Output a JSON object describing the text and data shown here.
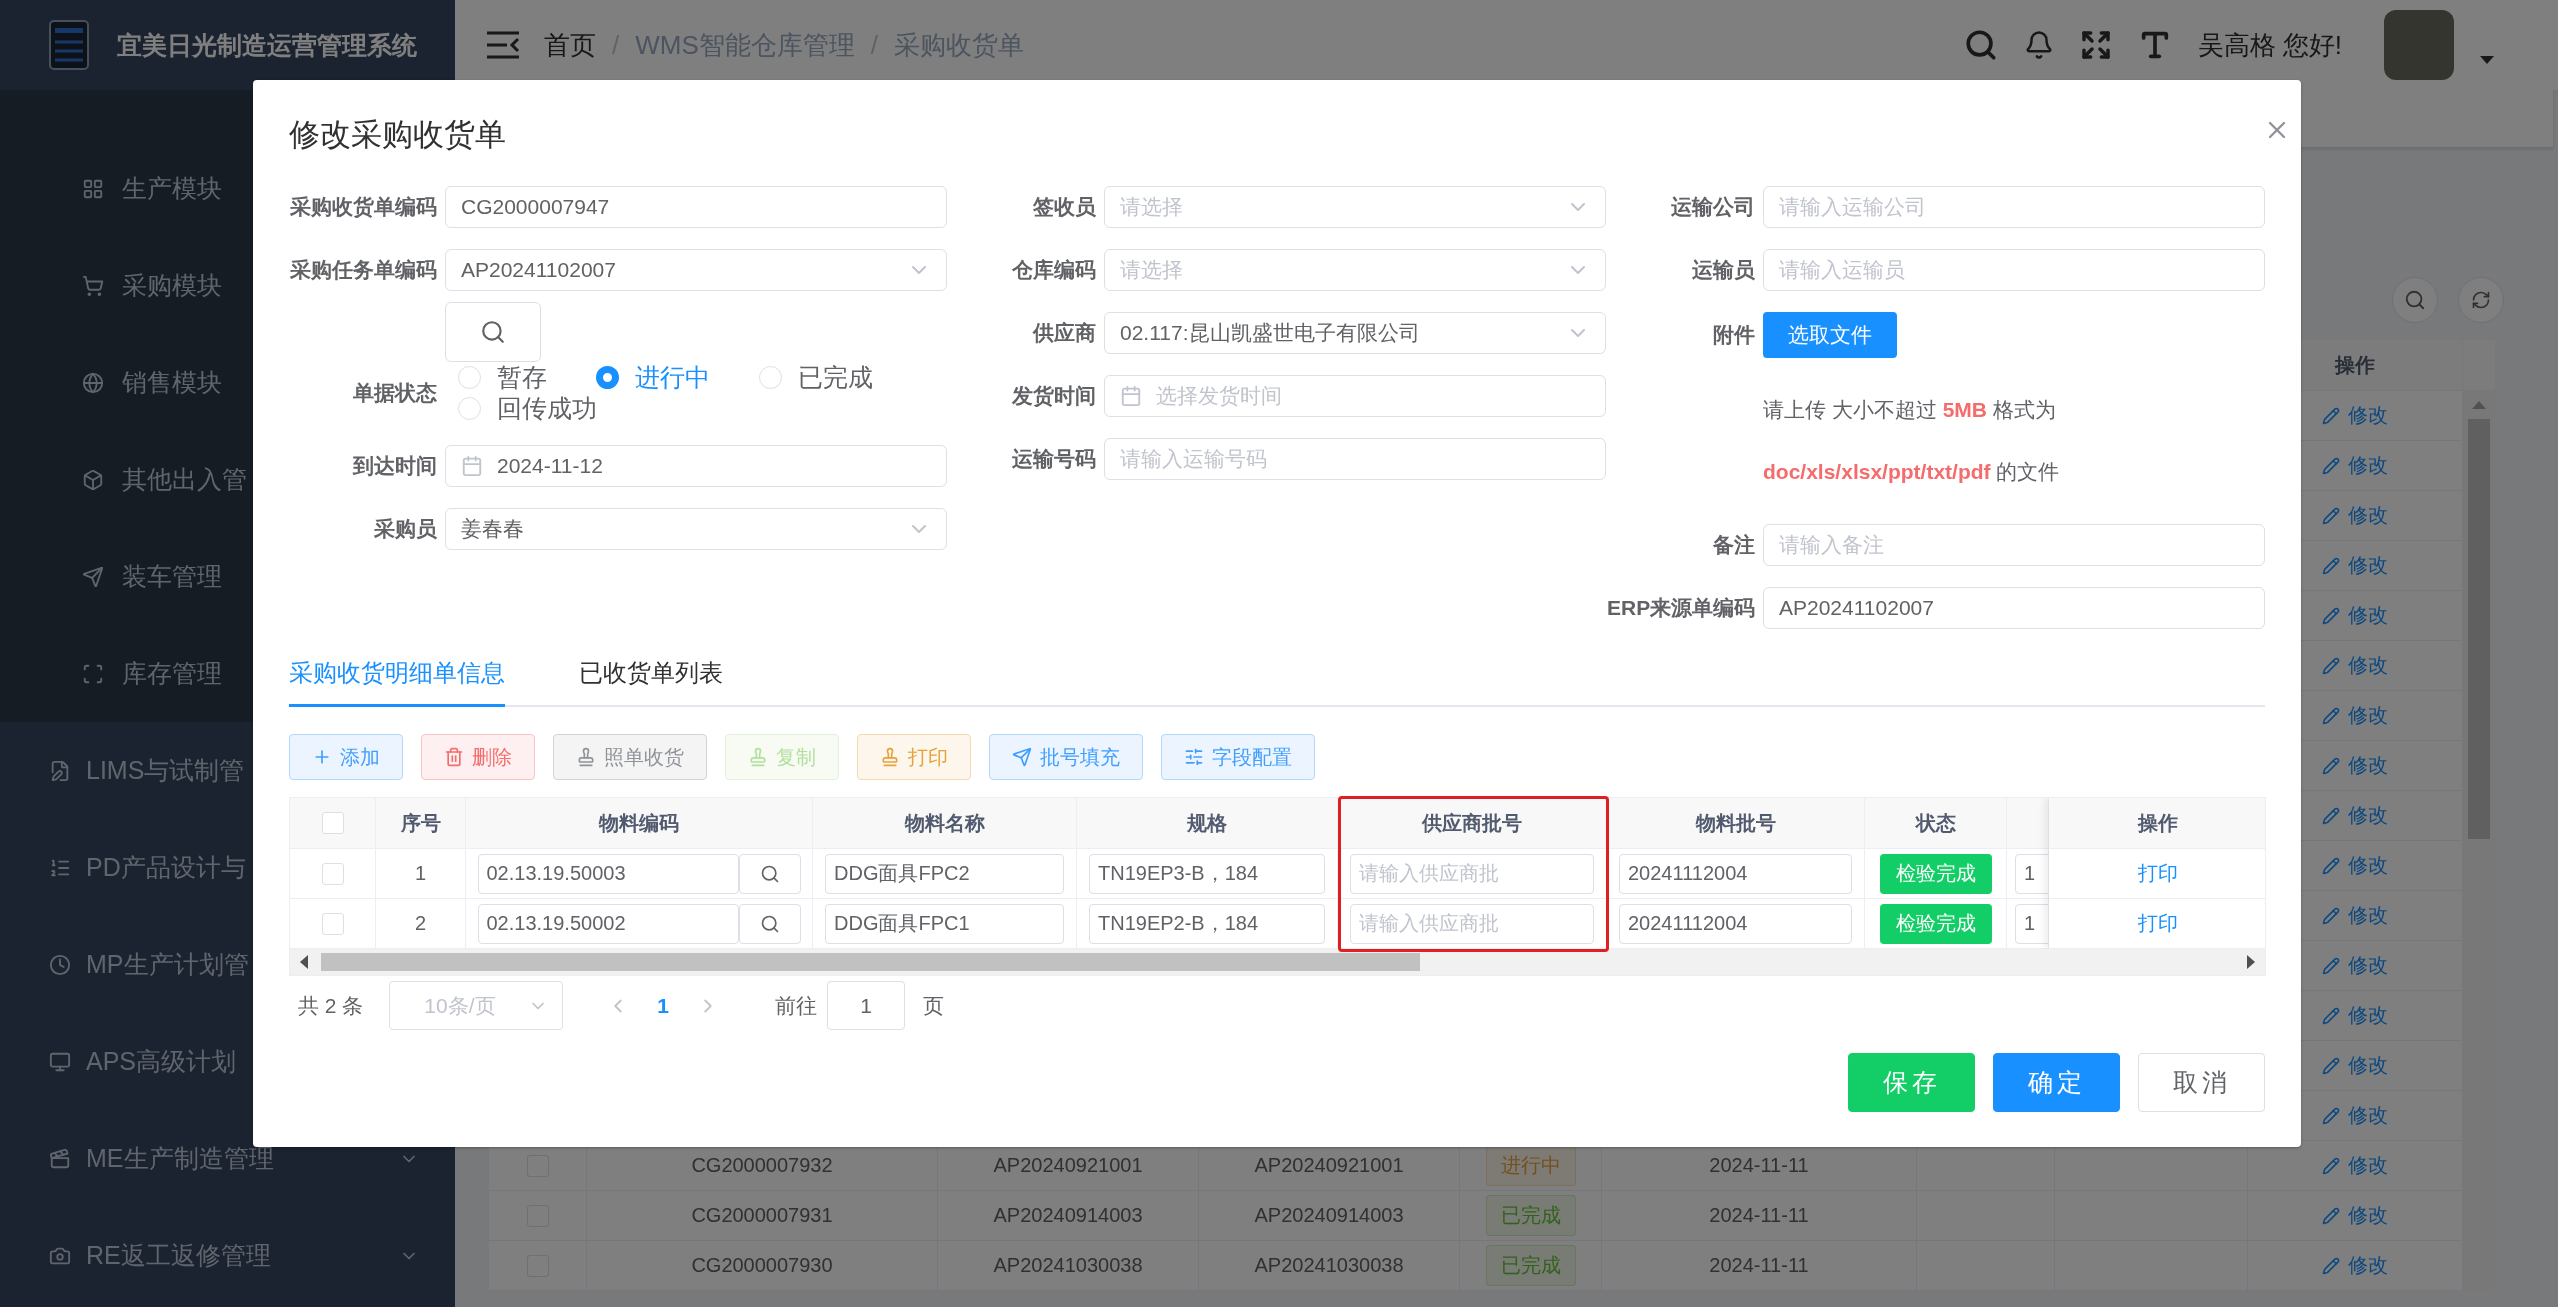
{
  "app": {
    "title": "宜美日光制造运营管理系统"
  },
  "sidebar": {
    "submenu": [
      {
        "label": "生产模块"
      },
      {
        "label": "采购模块"
      },
      {
        "label": "销售模块"
      },
      {
        "label": "其他出入管"
      },
      {
        "label": "装车管理"
      },
      {
        "label": "库存管理"
      }
    ],
    "items": [
      {
        "label": "LIMS与试制管"
      },
      {
        "label": "PD产品设计与"
      },
      {
        "label": "MP生产计划管"
      },
      {
        "label": "APS高级计划"
      },
      {
        "label": "ME生产制造管理",
        "expanded": false
      },
      {
        "label": "RE返工返修管理",
        "expanded": false
      }
    ]
  },
  "header": {
    "breadcrumb": {
      "separator": "/",
      "items": [
        "首页",
        "WMS智能仓库管理",
        "采购收货单"
      ]
    },
    "greeting": "吴高格 您好!"
  },
  "list_table": {
    "action_header": "操作",
    "rows": [
      {
        "action": "修改"
      },
      {
        "action": "修改"
      },
      {
        "action": "修改"
      },
      {
        "action": "修改"
      },
      {
        "action": "修改"
      },
      {
        "action": "修改"
      },
      {
        "action": "修改"
      },
      {
        "action": "修改"
      },
      {
        "action": "修改"
      },
      {
        "action": "修改"
      },
      {
        "action": "修改"
      },
      {
        "action": "修改"
      },
      {
        "action": "修改"
      },
      {
        "action": "修改"
      },
      {
        "action": "修改"
      },
      {
        "checked": false,
        "code": "CG2000007932",
        "task_no": "AP20240921001",
        "erp_no": "AP20240921001",
        "status": "进行中",
        "kind": "warning",
        "date": "2024-11-11",
        "action": "修改"
      },
      {
        "checked": false,
        "code": "CG2000007931",
        "task_no": "AP20240914003",
        "erp_no": "AP20240914003",
        "status": "已完成",
        "kind": "success",
        "date": "2024-11-11",
        "action": "修改"
      },
      {
        "checked": false,
        "code": "CG2000007930",
        "task_no": "AP20241030038",
        "erp_no": "AP20241030038",
        "status": "已完成",
        "kind": "success",
        "date": "2024-11-11",
        "action": "修改"
      }
    ]
  },
  "dialog": {
    "title": "修改采购收货单",
    "form": {
      "columns": [
        [
          {
            "kind": "input",
            "label": "采购收货单编码",
            "value": "CG2000007947"
          },
          {
            "kind": "select",
            "label": "采购任务单编码",
            "value": "AP20241102007"
          },
          {
            "kind": "search_button"
          },
          {
            "kind": "radio",
            "label": "单据状态",
            "options": [
              {
                "label": "暂存",
                "selected": false
              },
              {
                "label": "进行中",
                "selected": true
              },
              {
                "label": "已完成",
                "selected": false
              },
              {
                "label": "回传成功",
                "selected": false
              }
            ]
          },
          {
            "kind": "date",
            "label": "到达时间",
            "value": "2024-11-12"
          },
          {
            "kind": "select",
            "label": "采购员",
            "value": "姜春春"
          }
        ],
        [
          {
            "kind": "select",
            "label": "签收员",
            "placeholder": "请选择"
          },
          {
            "kind": "select",
            "label": "仓库编码",
            "placeholder": "请选择"
          },
          {
            "kind": "select",
            "label": "供应商",
            "value": "02.117:昆山凯盛世电子有限公司"
          },
          {
            "kind": "date",
            "label": "发货时间",
            "placeholder": "选择发货时间"
          },
          {
            "kind": "input",
            "label": "运输号码",
            "placeholder": "请输入运输号码"
          }
        ],
        [
          {
            "kind": "input",
            "label": "运输公司",
            "placeholder": "请输入运输公司"
          },
          {
            "kind": "input",
            "label": "运输员",
            "placeholder": "请输入运输员"
          },
          {
            "kind": "upload",
            "label": "附件",
            "button": "选取文件"
          },
          {
            "kind": "help",
            "text": "请上传 大小不超过 **5MB** 格式为 **doc/xls/xlsx/ppt/txt/pdf** 的文件"
          },
          {
            "kind": "input",
            "label": "备注",
            "placeholder": "请输入备注"
          },
          {
            "kind": "input",
            "label": "ERP来源单编码",
            "value": "AP20241102007"
          }
        ]
      ]
    },
    "tabs": [
      {
        "label": "采购收货明细单信息",
        "selected": true
      },
      {
        "label": "已收货单列表",
        "selected": false
      }
    ],
    "toolbar": [
      {
        "label": "添加",
        "kind": "primary",
        "disabled": false
      },
      {
        "label": "删除",
        "kind": "danger",
        "disabled": false
      },
      {
        "label": "照单收货",
        "kind": "info",
        "disabled": false
      },
      {
        "label": "复制",
        "kind": "success",
        "disabled": true
      },
      {
        "label": "打印",
        "kind": "warning",
        "disabled": false
      },
      {
        "label": "批号填充",
        "kind": "primary",
        "disabled": false
      },
      {
        "label": "字段配置",
        "kind": "primary",
        "disabled": false
      }
    ],
    "detail_table": {
      "all_checked": false,
      "columns": [
        {
          "label": "序号",
          "highlighted": false
        },
        {
          "label": "物料编码",
          "highlighted": false
        },
        {
          "label": "物料名称",
          "highlighted": false
        },
        {
          "label": "规格",
          "highlighted": false
        },
        {
          "label": "供应商批号",
          "highlighted": true
        },
        {
          "label": "物料批号",
          "highlighted": false
        },
        {
          "label": "状态",
          "highlighted": false
        },
        {
          "label": "操作",
          "highlighted": false
        }
      ],
      "rows": [
        {
          "checked": false,
          "index": "1",
          "material_code": "02.13.19.50003",
          "material_name": "DDG面具FPC2",
          "spec": "TN19EP3-B，184",
          "supplier_batch_placeholder": "请输入供应商批",
          "batch": "20241112004",
          "status": "检验完成",
          "column_9": "1",
          "action": "打印"
        },
        {
          "checked": false,
          "index": "2",
          "material_code": "02.13.19.50002",
          "material_name": "DDG面具FPC1",
          "spec": "TN19EP2-B，184",
          "supplier_batch_placeholder": "请输入供应商批",
          "batch": "20241112004",
          "status": "检验完成",
          "column_9": "1",
          "action": "打印"
        }
      ]
    },
    "pagination": {
      "total": "共 2 条",
      "page_size": "10条/页",
      "pages": [
        {
          "label": "1",
          "selected": true
        }
      ],
      "goto_label": "前往",
      "goto_value": "1",
      "page_suffix": "页"
    },
    "footer": [
      {
        "label": "保存",
        "kind": "success"
      },
      {
        "label": "确定",
        "kind": "primary"
      },
      {
        "label": "取消",
        "kind": "default"
      }
    ]
  }
}
